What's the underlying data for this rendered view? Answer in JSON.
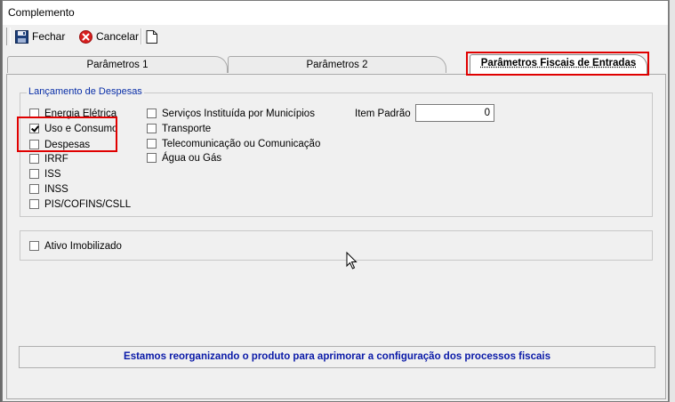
{
  "window": {
    "title": "Complemento"
  },
  "toolbar": {
    "close_label": "Fechar",
    "cancel_label": "Cancelar",
    "icons": {
      "close": "floppy-disk-icon",
      "cancel": "red-cancel-icon",
      "document": "blank-document-icon"
    }
  },
  "tabs": [
    {
      "label": "Parâmetros 1",
      "active": false
    },
    {
      "label": "Parâmetros 2",
      "active": false
    },
    {
      "label": "Parâmetros Fiscais de Entradas",
      "active": true
    }
  ],
  "expenses_group": {
    "legend": "Lançamento de Despesas",
    "col1": [
      {
        "label": "Energia Elétrica",
        "checked": false
      },
      {
        "label": "Uso e Consumo",
        "checked": true
      },
      {
        "label": "Despesas",
        "checked": false
      },
      {
        "label": "IRRF",
        "checked": false
      },
      {
        "label": "ISS",
        "checked": false
      },
      {
        "label": "INSS",
        "checked": false
      },
      {
        "label": "PIS/COFINS/CSLL",
        "checked": false
      }
    ],
    "col2": [
      {
        "label": "Serviços Instituída por Municípios",
        "checked": false
      },
      {
        "label": "Transporte",
        "checked": false
      },
      {
        "label": "Telecomunicação ou Comunicação",
        "checked": false
      },
      {
        "label": "Água ou Gás",
        "checked": false
      }
    ],
    "item_padrao": {
      "label": "Item Padrão",
      "value": "0"
    }
  },
  "fixed_assets": {
    "label": "Ativo Imobilizado",
    "checked": false
  },
  "info_message": "Estamos reorganizando o produto para aprimorar a configuração dos processos fiscais",
  "colors": {
    "highlight": "#e00000",
    "legend_text": "#0a2fa8",
    "info_text": "#0a1aa8"
  }
}
